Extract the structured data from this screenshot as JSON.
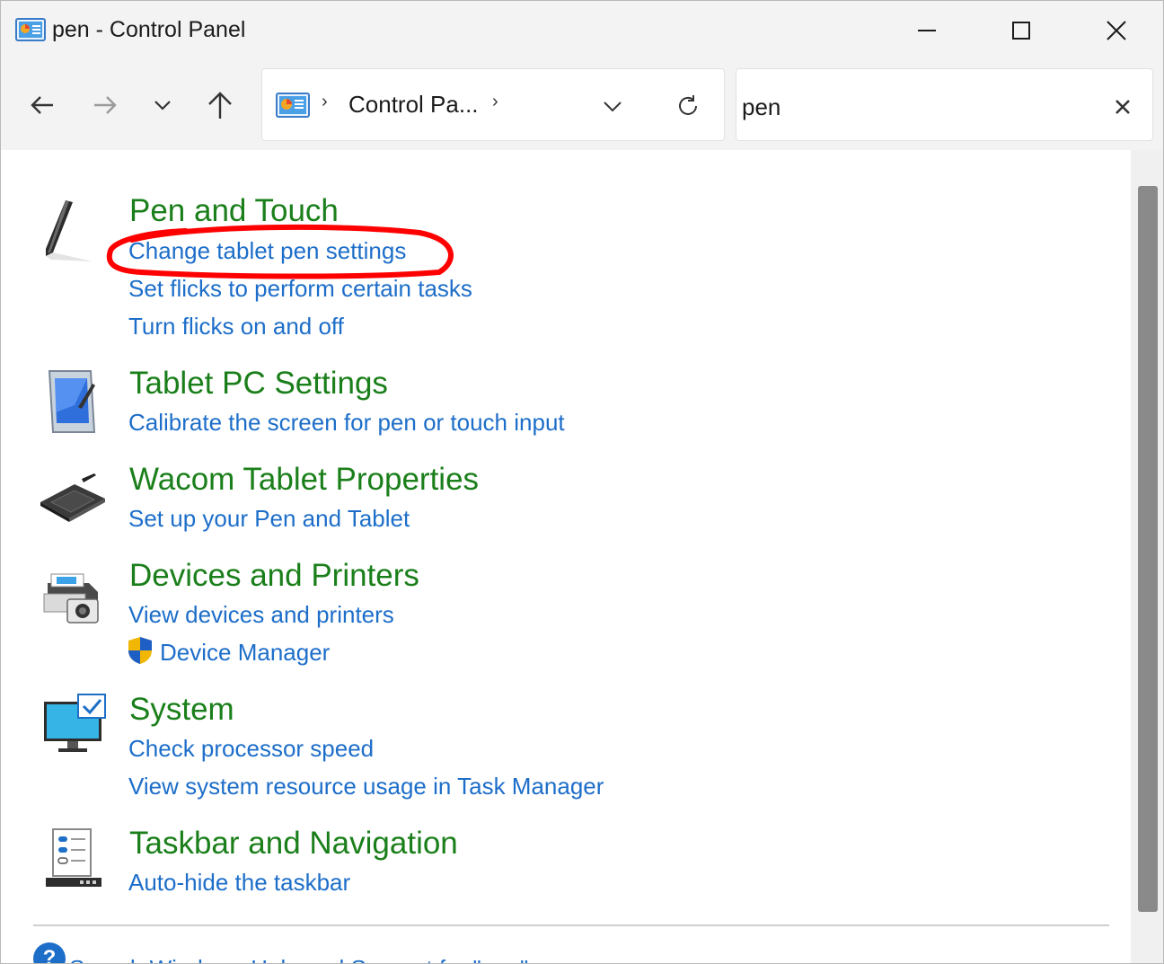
{
  "window": {
    "title": "pen - Control Panel",
    "minimize_label": "Minimize",
    "maximize_label": "Maximize",
    "close_label": "Close"
  },
  "navigation": {
    "back_icon": "arrow-left-icon",
    "forward_icon": "arrow-right-icon",
    "recent_icon": "chevron-down-icon",
    "up_icon": "arrow-up-icon"
  },
  "address_bar": {
    "breadcrumb": "Control Pa...",
    "separator": "›"
  },
  "search": {
    "value": "pen",
    "clear_icon": "close-icon"
  },
  "results": [
    {
      "title": "Pen and Touch",
      "icon": "pen-icon",
      "links": [
        "Change tablet pen settings",
        "Set flicks to perform certain tasks",
        "Turn flicks on and off"
      ]
    },
    {
      "title": "Tablet PC Settings",
      "icon": "tablet-icon",
      "links": [
        "Calibrate the screen for pen or touch input"
      ]
    },
    {
      "title": "Wacom Tablet Properties",
      "icon": "wacom-tablet-icon",
      "links": [
        "Set up your Pen and Tablet"
      ]
    },
    {
      "title": "Devices and Printers",
      "icon": "printer-icon",
      "links": [
        "View devices and printers",
        "Device Manager"
      ]
    },
    {
      "title": "System",
      "icon": "monitor-check-icon",
      "links": [
        "Check processor speed",
        "View system resource usage in Task Manager"
      ]
    },
    {
      "title": "Taskbar and Navigation",
      "icon": "taskbar-icon",
      "links": [
        "Auto-hide the taskbar"
      ]
    }
  ],
  "help": {
    "text": "Search Windows Help and Support for \"pen\"",
    "icon_glyph": "?"
  },
  "colors": {
    "title_green": "#1a7f1a",
    "link_blue": "#1d6ec9",
    "annotation_red": "#ff0000"
  }
}
